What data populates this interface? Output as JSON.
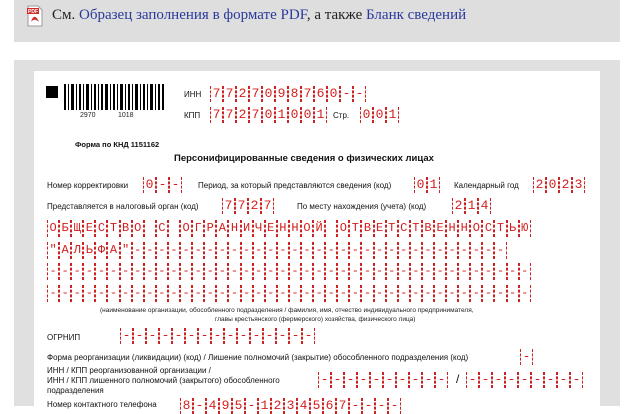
{
  "topbar": {
    "prefix": "См.",
    "link1": "Образец заполнения в формате PDF",
    "middle": ", а также",
    "link2": "Бланк сведений",
    "pdf_icon_text": "PDF"
  },
  "form": {
    "barcode_left": "2970",
    "barcode_right": "1018",
    "inn_label": "ИНН",
    "inn_value": "7727098760--",
    "kpp_label": "КПП",
    "kpp_value": "772701001",
    "page_label": "Стр.",
    "page_value": "001",
    "knd_label": "Форма по КНД 1151162",
    "title": "Персонифицированные сведения о физических лицах",
    "correction_label": "Номер корректировки",
    "correction_value": "0--",
    "period_label": "Период, за который представляются сведения (код)",
    "period_value": "01",
    "year_label": "Календарный год",
    "year_value": "2023",
    "tax_organ_label": "Представляется в налоговый орган (код)",
    "tax_organ_value": "7727",
    "location_label": "По месту нахождения (учета) (код)",
    "location_value": "214",
    "org_row1": "ОБЩЕСТВО С ОГРАНИЧЕННОЙ ОТВЕТСТВЕННОСТЬЮ",
    "org_row2": "\"АЛЬФА\"-------------------------------",
    "org_row3": "----------------------------------------",
    "org_row4": "----------------------------------------",
    "org_caption": "(наименование организации, обособленного подразделения / фамилия, имя, отчество индивидуального предпринимателя,",
    "org_caption2": "главы крестьянского (фермерского) хозяйства, физического лица)",
    "ogrnip_label": "ОГРНИП",
    "ogrnip_value": "---------------",
    "reorg_label": "Форма реорганизации (ликвидации) (код) / Лишение полномочий (закрытие) обособленного подразделения (код)",
    "reorg_value": "-",
    "inn_kpp_reorg_label1": "ИНН / КПП реорганизованной организации /",
    "inn_kpp_reorg_label2": "ИНН / КПП лишенного полномочий (закрытого) обособленного",
    "inn_kpp_reorg_label3": "подразделения",
    "inn_kpp_reorg_inn": "----------",
    "inn_kpp_reorg_kpp": "---------",
    "slash": "/",
    "phone_label": "Номер контактного телефона",
    "phone_value": "8-495-1234567----"
  },
  "colors": {
    "accent_red": "#d41e1e",
    "link_blue": "#2a3a9c"
  }
}
